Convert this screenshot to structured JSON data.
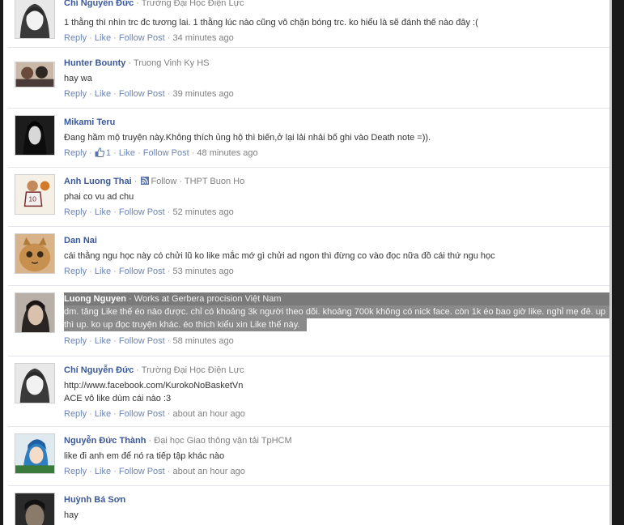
{
  "colors": {
    "link": "#6d84b4",
    "author": "#3b5998",
    "meta": "#808080",
    "highlight": "#8a8a8a"
  },
  "actions": {
    "reply": "Reply",
    "like": "Like",
    "follow_post": "Follow Post",
    "dot": " · "
  },
  "comments": [
    {
      "author": "Chí Nguyễn Đức",
      "meta": "Trường Đại Học Điện Lực",
      "lines": [
        "1 thằng thì nhìn trc đc tương lai. 1 thằng lúc nào cũng vô chặn bóng trc. ko hiểu là sẽ đánh thế nào đây :("
      ],
      "time": "34 minutes ago"
    },
    {
      "author": "Hunter Bounty",
      "meta": "Truong Vinh Ky HS",
      "lines": [
        "hay wa"
      ],
      "time": "39 minutes ago"
    },
    {
      "author": "Mikami Teru",
      "meta": "",
      "lines": [
        "Đang hầm mộ truyện này.Không thích ủng hộ thì biến,ở lại lải nhải bố ghi vào Death note =))."
      ],
      "like_count": "1",
      "time": "48 minutes ago"
    },
    {
      "author": "Anh Luong Thai",
      "follow_label": "Follow",
      "meta": "THPT Buon Ho",
      "lines": [
        "phai co vu ad chu"
      ],
      "time": "52 minutes ago"
    },
    {
      "author": "Dan Nai",
      "meta": "",
      "lines": [
        "cái thằng ngu học này có chửi lũ ko like mắc mớ gì chửi ad ngon thì đừng co vào đọc nữa đồ cái thứ ngu học"
      ],
      "time": "53 minutes ago"
    },
    {
      "author": "Luong Nguyen",
      "meta": "Works at Gerbera procision Việt Nam",
      "lines": [
        "dm. tăng Like thế éo nào được. chỉ có khoảng 3k người theo dõi. khoảng 700k không có nick face. còn 1k éo bao giờ like. nghỉ mẹ đê. up",
        "thì up. ko up đọc truyện khác. éo thích kiểu xin Like thế này."
      ],
      "time": "58 minutes ago"
    },
    {
      "author": "Chí Nguyễn Đức",
      "meta": "Trường Đại Học Điện Lực",
      "lines": [
        "http://www.facebook.com/KurokoNoBasketVn",
        "ACE vô like dùm cái nào :3"
      ],
      "time": "about an hour ago"
    },
    {
      "author": "Nguyễn Đức Thành",
      "meta": "Đại học Giao thông vận tải TpHCM",
      "lines": [
        "like đi anh em để nó ra tiếp tập khác nào"
      ],
      "time": "about an hour ago"
    },
    {
      "author": "Huỳnh Bá Sơn",
      "meta": "",
      "lines": [
        "hay"
      ],
      "time": ""
    }
  ]
}
